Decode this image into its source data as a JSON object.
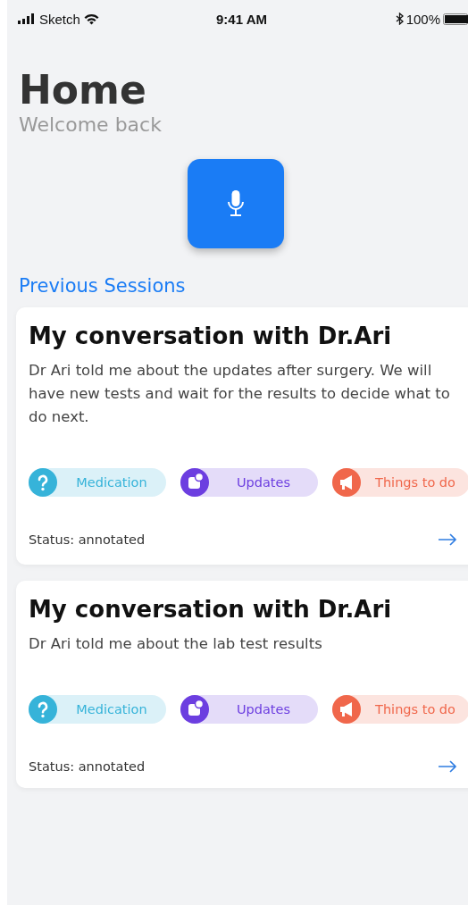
{
  "status_bar": {
    "carrier": "Sketch",
    "time": "9:41 AM",
    "battery": "100%"
  },
  "header": {
    "title": "Home",
    "subtitle": "Welcome back"
  },
  "section_title": "Previous Sessions",
  "sessions": [
    {
      "title": "My conversation with Dr.Ari",
      "summary": "Dr Ari told me about the updates after surgery. We will have new tests and wait for the results to decide what to do next.",
      "tags": [
        {
          "kind": "question",
          "label": "Medication",
          "color": "#36b3d9"
        },
        {
          "kind": "updates",
          "label": "Updates",
          "color": "#6c3ee0"
        },
        {
          "kind": "megaphone",
          "label": "Things to do",
          "color": "#f0674b"
        }
      ],
      "status": "Status: annotated"
    },
    {
      "title": "My conversation with Dr.Ari",
      "summary": "Dr Ari told me about the lab test results",
      "tags": [
        {
          "kind": "question",
          "label": "Medication",
          "color": "#36b3d9"
        },
        {
          "kind": "updates",
          "label": "Updates",
          "color": "#6c3ee0"
        },
        {
          "kind": "megaphone",
          "label": "Things to do",
          "color": "#f0674b"
        }
      ],
      "status": "Status: annotated"
    }
  ]
}
